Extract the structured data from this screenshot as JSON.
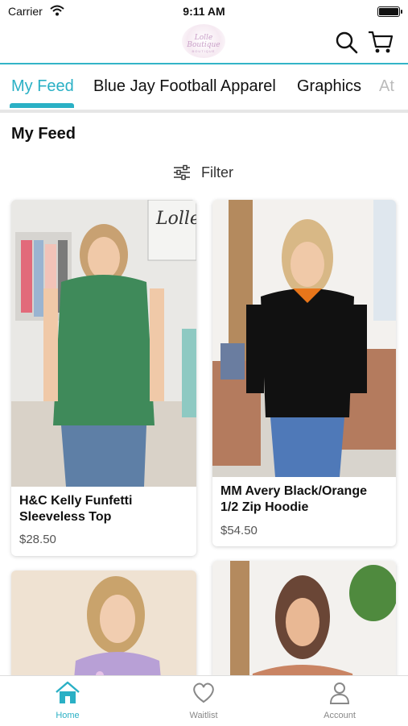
{
  "status_bar": {
    "carrier": "Carrier",
    "time": "9:11 AM"
  },
  "header": {
    "logo_text": "Lolle Boutique",
    "logo_sub": "BOUTIQUE",
    "search_icon": "search-icon",
    "cart_icon": "cart-icon",
    "accent_color": "#2ab0c5"
  },
  "tabs": [
    {
      "label": "My Feed",
      "active": true
    },
    {
      "label": "Blue Jay Football Apparel",
      "active": false
    },
    {
      "label": "Graphics",
      "active": false
    },
    {
      "label": "At",
      "active": false
    }
  ],
  "section": {
    "title": "My Feed"
  },
  "filter": {
    "label": "Filter",
    "icon": "sliders-icon"
  },
  "products": [
    {
      "name_line1": "H&C Kelly Funfetti",
      "name_line2": "Sleeveless Top",
      "price": "$28.50"
    },
    {
      "name_line1": "MM Avery Black/Orange",
      "name_line2": "1/2 Zip Hoodie",
      "price": "$54.50"
    },
    {
      "name_line1": "",
      "name_line2": "",
      "price": ""
    },
    {
      "name_line1": "",
      "name_line2": "",
      "price": ""
    }
  ],
  "tab_bar": {
    "items": [
      {
        "label": "Home",
        "icon": "home-icon",
        "active": true
      },
      {
        "label": "Waitlist",
        "icon": "heart-icon",
        "active": false
      },
      {
        "label": "Account",
        "icon": "person-icon",
        "active": false
      }
    ]
  }
}
